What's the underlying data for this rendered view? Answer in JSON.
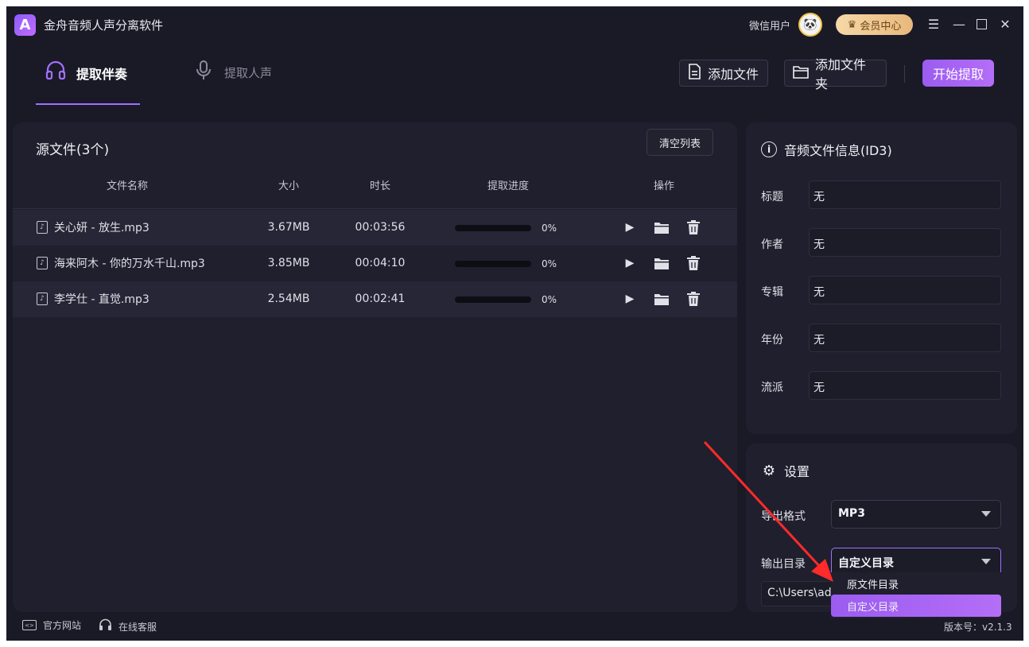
{
  "app": {
    "title": "金舟音频人声分离软件",
    "logo_letter": "A",
    "user_name": "微信用户",
    "vip_label": "会员中心"
  },
  "tabs": [
    {
      "label": "提取伴奏",
      "active": true
    },
    {
      "label": "提取人声",
      "active": false
    }
  ],
  "toolbar": {
    "add_file": "添加文件",
    "add_folder": "添加文件夹",
    "start": "开始提取"
  },
  "source": {
    "title": "源文件(3个)",
    "clear_label": "清空列表",
    "columns": [
      "文件名称",
      "大小",
      "时长",
      "提取进度",
      "操作"
    ],
    "rows": [
      {
        "name": "关心妍 - 放生.mp3",
        "size": "3.67MB",
        "duration": "00:03:56",
        "progress": "0%",
        "progress_value": 0
      },
      {
        "name": "海来阿木 - 你的万水千山.mp3",
        "size": "3.85MB",
        "duration": "00:04:10",
        "progress": "0%",
        "progress_value": 0
      },
      {
        "name": "李学仕 - 直觉.mp3",
        "size": "2.54MB",
        "duration": "00:02:41",
        "progress": "0%",
        "progress_value": 0
      }
    ]
  },
  "id3": {
    "title": "音频文件信息(ID3)",
    "fields": [
      {
        "label": "标题",
        "value": "无"
      },
      {
        "label": "作者",
        "value": "无"
      },
      {
        "label": "专辑",
        "value": "无"
      },
      {
        "label": "年份",
        "value": "无"
      },
      {
        "label": "流派",
        "value": "无"
      }
    ]
  },
  "settings": {
    "title": "设置",
    "format_label": "导出格式",
    "format_value": "MP3",
    "dir_label": "输出目录",
    "dir_value": "自定义目录",
    "path_value": "C:\\Users\\adr",
    "dir_options": [
      {
        "label": "原文件目录",
        "selected": false
      },
      {
        "label": "自定义目录",
        "selected": true
      }
    ]
  },
  "footer": {
    "website": "官方网站",
    "support": "在线客服",
    "version": "版本号：v2.1.3"
  },
  "colors": {
    "accent": "#9b5cf0",
    "background": "#1a1a27",
    "panel": "#1f1f2d",
    "annotation_arrow": "#ff2a2a"
  }
}
